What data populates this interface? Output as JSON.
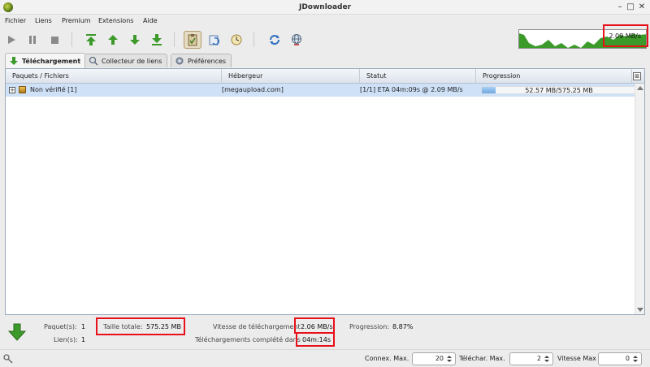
{
  "window": {
    "title": "JDownloader",
    "minimize_glyph": "–",
    "maximize_glyph": "□",
    "close_glyph": "✕"
  },
  "menu": [
    "Fichier",
    "Liens",
    "Premium",
    "Extensions",
    "Aide"
  ],
  "toolbar": {
    "buttons": [
      "play-icon",
      "pause-icon",
      "stop-icon",
      "move-top-icon",
      "move-up-icon",
      "move-down-icon",
      "move-bottom-icon",
      "clipboard-icon",
      "reconnect-icon",
      "update-icon",
      "refresh-icon",
      "globe-icon"
    ],
    "speed_readout": "2.09 MB/s"
  },
  "tabs": [
    {
      "label": "Téléchargement",
      "icon": "download-arrow-icon",
      "active": true
    },
    {
      "label": "Collecteur de liens",
      "icon": "link-collector-icon",
      "active": false
    },
    {
      "label": "Préférences",
      "icon": "settings-icon",
      "active": false
    }
  ],
  "table": {
    "columns": [
      "Paquets / Fichiers",
      "Hébergeur",
      "Statut",
      "Progression"
    ],
    "column_toggle_glyph": "⊞",
    "rows": [
      {
        "expander": "+",
        "name": "Non vérifié [1]",
        "host": "[megaupload.com]",
        "status": "[1/1] ETA 04m:09s @ 2.09 MB/s",
        "progress_text": "52.57 MB/575.25 MB",
        "progress_fraction": 0.0914
      }
    ]
  },
  "status": {
    "packages_label": "Paquet(s):",
    "packages_value": "1",
    "links_label": "Lien(s):",
    "links_value": "1",
    "total_size_label": "Taille totale:",
    "total_size_value": "575.25 MB",
    "speed_label": "Vitesse de téléchargement",
    "speed_value": "2.06 MB/s",
    "complete_label": "Téléchargements complété dans",
    "complete_value": "04m:14s",
    "progress_label": "Progression:",
    "progress_value": "8.87%"
  },
  "bottom": {
    "max_connections_label": "Connex. Max.",
    "max_connections_value": "20",
    "max_downloads_label": "Téléchar. Max.",
    "max_downloads_value": "2",
    "max_speed_label": "Vitesse Max",
    "max_speed_value": "0"
  },
  "colors": {
    "accent_green": "#3c9a2a",
    "highlight_red": "#e8101a",
    "selected_row": "#cfe1f7"
  }
}
